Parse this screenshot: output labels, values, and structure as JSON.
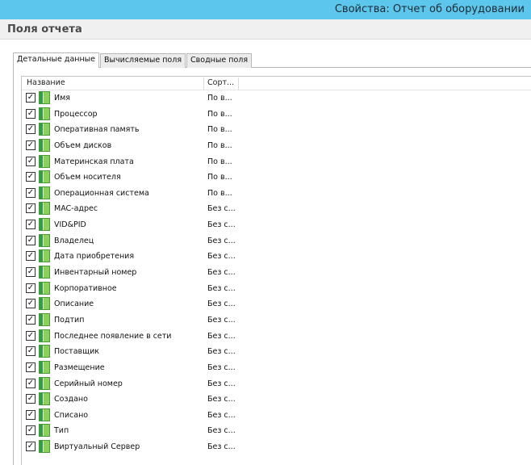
{
  "window": {
    "title": "Свойства: Отчет об оборудовании"
  },
  "section": {
    "title": "Поля отчета"
  },
  "tabs": [
    {
      "label": "Детальные данные",
      "active": true
    },
    {
      "label": "Вычисляемые поля",
      "active": false
    },
    {
      "label": "Сводные поля",
      "active": false
    }
  ],
  "list": {
    "columns": {
      "name": "Название",
      "sort": "Сорт..."
    },
    "rows": [
      {
        "checked": true,
        "name": "Имя",
        "sort": "По в..."
      },
      {
        "checked": true,
        "name": "Процессор",
        "sort": "По в..."
      },
      {
        "checked": true,
        "name": "Оперативная память",
        "sort": "По в..."
      },
      {
        "checked": true,
        "name": "Объем дисков",
        "sort": "По в..."
      },
      {
        "checked": true,
        "name": "Материнская плата",
        "sort": "По в..."
      },
      {
        "checked": true,
        "name": "Объем носителя",
        "sort": "По в..."
      },
      {
        "checked": true,
        "name": "Операционная система",
        "sort": "По в..."
      },
      {
        "checked": true,
        "name": "MAC-адрес",
        "sort": "Без с..."
      },
      {
        "checked": true,
        "name": "VID&PID",
        "sort": "Без с..."
      },
      {
        "checked": true,
        "name": "Владелец",
        "sort": "Без с..."
      },
      {
        "checked": true,
        "name": "Дата приобретения",
        "sort": "Без с..."
      },
      {
        "checked": true,
        "name": "Инвентарный номер",
        "sort": "Без с..."
      },
      {
        "checked": true,
        "name": "Корпоративное",
        "sort": "Без с..."
      },
      {
        "checked": true,
        "name": "Описание",
        "sort": "Без с..."
      },
      {
        "checked": true,
        "name": "Подтип",
        "sort": "Без с..."
      },
      {
        "checked": true,
        "name": "Последнее появление в сети",
        "sort": "Без с..."
      },
      {
        "checked": true,
        "name": "Поставщик",
        "sort": "Без с..."
      },
      {
        "checked": true,
        "name": "Размещение",
        "sort": "Без с..."
      },
      {
        "checked": true,
        "name": "Серийный номер",
        "sort": "Без с..."
      },
      {
        "checked": true,
        "name": "Создано",
        "sort": "Без с..."
      },
      {
        "checked": true,
        "name": "Списано",
        "sort": "Без с..."
      },
      {
        "checked": true,
        "name": "Тип",
        "sort": "Без с..."
      },
      {
        "checked": true,
        "name": "Виртуальный Сервер",
        "sort": "Без с..."
      }
    ]
  }
}
